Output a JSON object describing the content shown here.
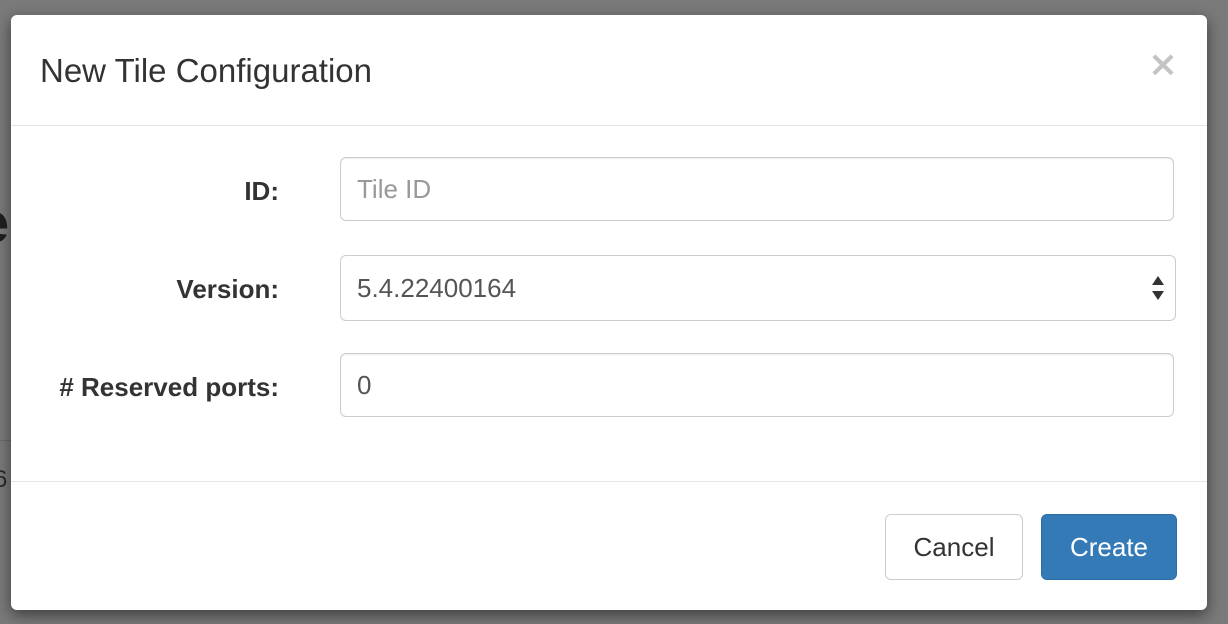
{
  "background": {
    "fragment_1": "e",
    "fragment_2": "6"
  },
  "modal": {
    "title": "New Tile Configuration",
    "close_label": "×",
    "fields": {
      "id": {
        "label": "ID:",
        "value": "",
        "placeholder": "Tile ID"
      },
      "version": {
        "label": "Version:",
        "selected": "5.4.22400164"
      },
      "reserved_ports": {
        "label": "# Reserved ports:",
        "value": "0"
      }
    },
    "buttons": {
      "cancel_label": "Cancel",
      "create_label": "Create"
    }
  },
  "colors": {
    "primary": "#337ab7",
    "backdrop": "#7a7a7a",
    "close_icon": "#c4c4c4"
  }
}
